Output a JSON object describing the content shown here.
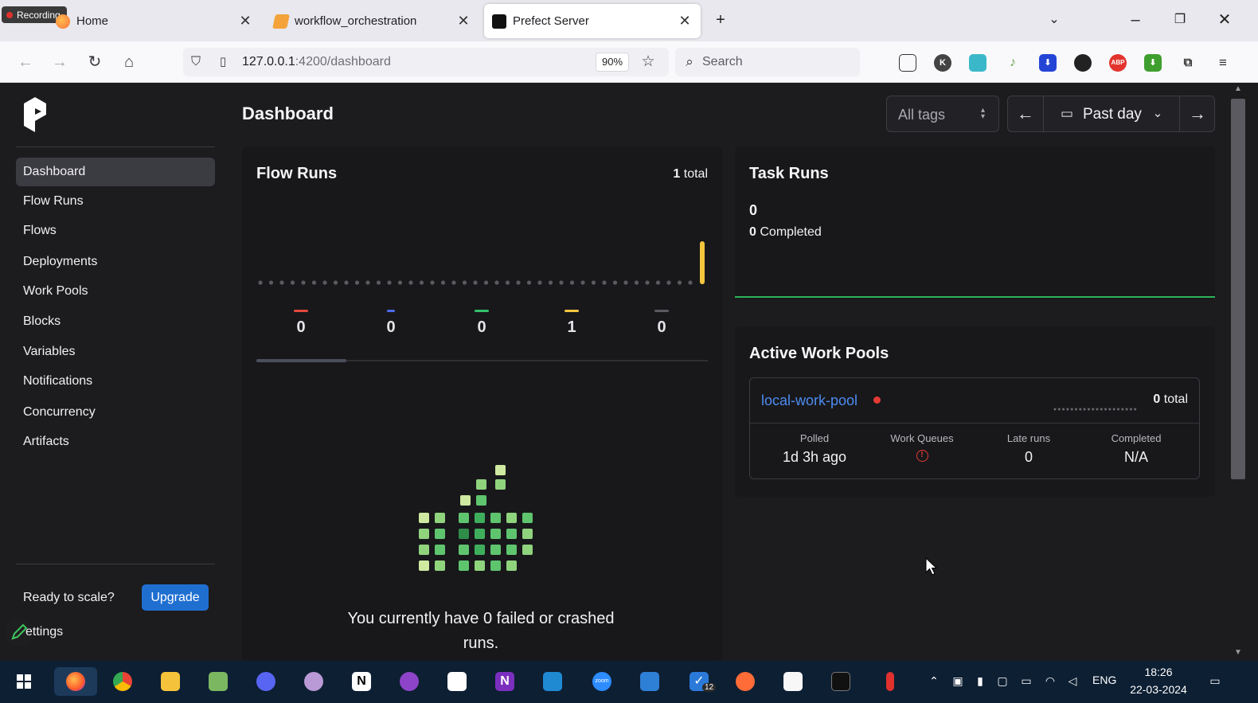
{
  "browser": {
    "recording_label": "Recording",
    "tabs": [
      {
        "label": "Home",
        "icon": "firefox-home-icon"
      },
      {
        "label": "workflow_orchestration",
        "icon": "jupyter-notebook-icon"
      },
      {
        "label": "Prefect Server",
        "icon": "prefect-icon",
        "active": true
      }
    ],
    "url_host": "127.0.0.1",
    "url_path": ":4200/dashboard",
    "zoom": "90%",
    "search_placeholder": "Search"
  },
  "sidebar": {
    "items": [
      {
        "label": "Dashboard",
        "active": true
      },
      {
        "label": "Flow Runs"
      },
      {
        "label": "Flows"
      },
      {
        "label": "Deployments"
      },
      {
        "label": "Work Pools"
      },
      {
        "label": "Blocks"
      },
      {
        "label": "Variables"
      },
      {
        "label": "Notifications"
      },
      {
        "label": "Concurrency"
      },
      {
        "label": "Artifacts"
      }
    ],
    "ready_text": "Ready to scale?",
    "upgrade_label": "Upgrade",
    "settings_label": "ettings"
  },
  "header": {
    "title": "Dashboard",
    "tags_placeholder": "All tags",
    "range_label": "Past day"
  },
  "flow_runs": {
    "title": "Flow Runs",
    "total_count": "1",
    "total_suffix": "total",
    "states": [
      {
        "value": "0",
        "color": "#e5473c"
      },
      {
        "value": "0",
        "color": "#4b6cf0"
      },
      {
        "value": "0",
        "color": "#34c06a"
      },
      {
        "value": "1",
        "color": "#f4c63d"
      },
      {
        "value": "0",
        "color": "#5a5a60"
      }
    ],
    "empty_message": "You currently have 0 failed or crashed runs."
  },
  "task_runs": {
    "title": "Task Runs",
    "count": "0",
    "completed_count": "0",
    "completed_label": "Completed"
  },
  "work_pools": {
    "title": "Active Work Pools",
    "pool": {
      "name": "local-work-pool",
      "total_count": "0",
      "total_suffix": "total",
      "stats": [
        {
          "label": "Polled",
          "value": "1d 3h ago"
        },
        {
          "label": "Work Queues",
          "value": ""
        },
        {
          "label": "Late runs",
          "value": "0"
        },
        {
          "label": "Completed",
          "value": "N/A"
        }
      ]
    }
  },
  "taskbar": {
    "language": "ENG",
    "time": "18:26",
    "date": "22-03-2024",
    "badge": "12"
  },
  "colors": {
    "accent": "#1f6fd1",
    "completed_line": "#2fb35a",
    "link": "#4d8cf0",
    "status_red": "#e53a34"
  }
}
